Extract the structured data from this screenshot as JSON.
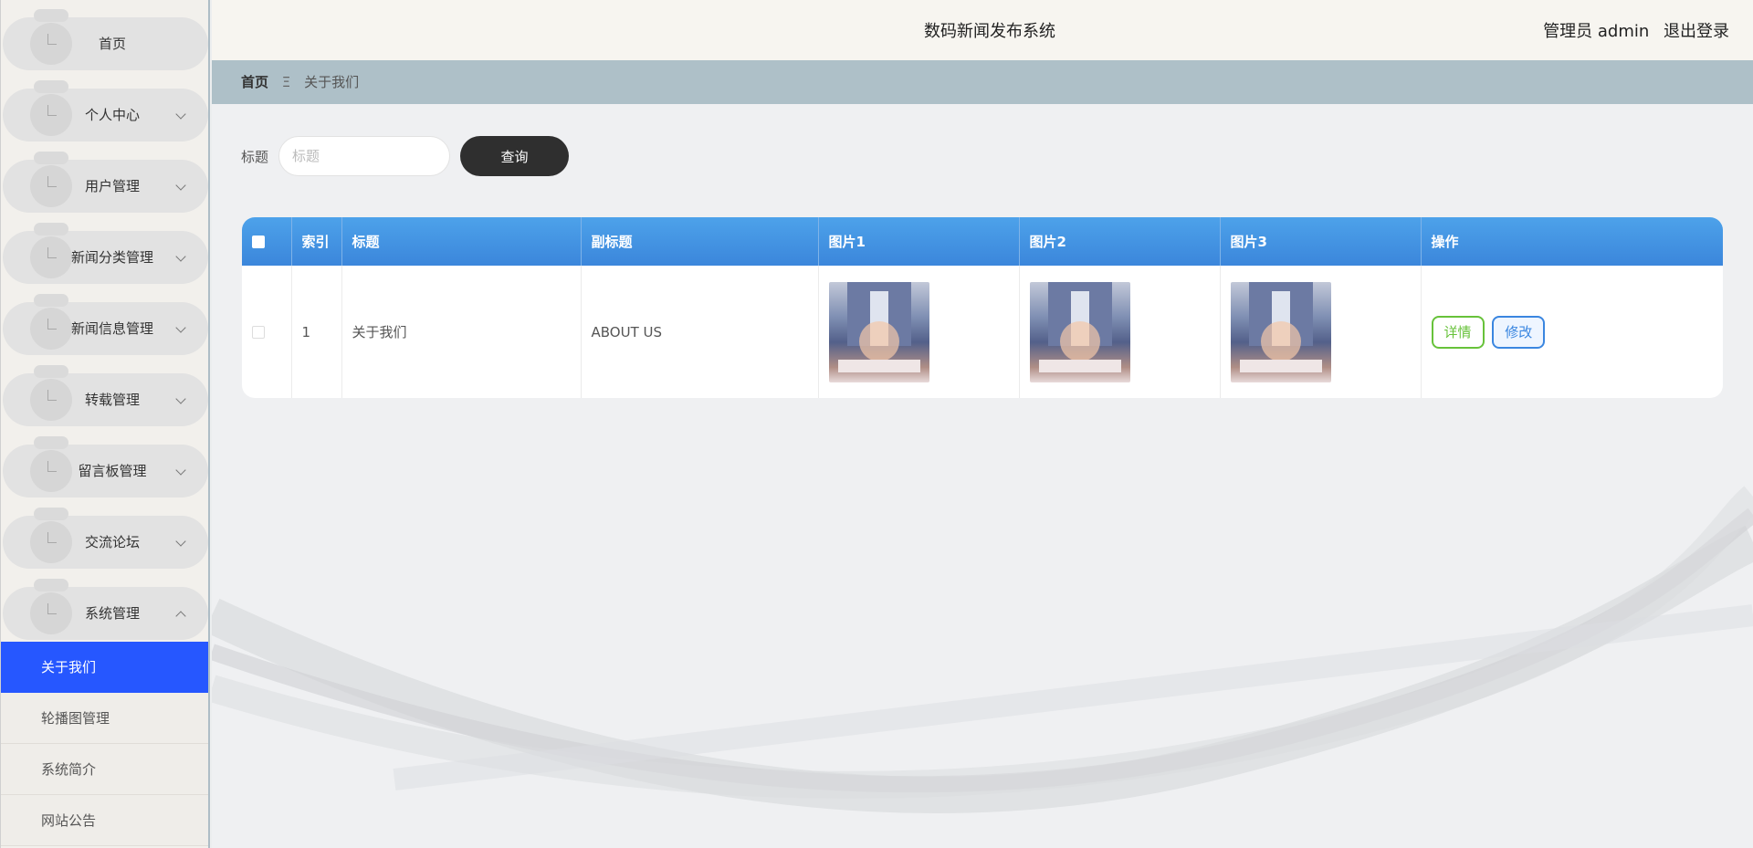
{
  "header": {
    "title": "数码新闻发布系统",
    "user_label": "管理员 admin",
    "logout_label": "退出登录"
  },
  "breadcrumb": {
    "home": "首页",
    "separator": "Ξ",
    "current": "关于我们"
  },
  "sidebar": {
    "items": [
      {
        "label": "首页"
      },
      {
        "label": "个人中心"
      },
      {
        "label": "用户管理"
      },
      {
        "label": "新闻分类管理"
      },
      {
        "label": "新闻信息管理"
      },
      {
        "label": "转载管理"
      },
      {
        "label": "留言板管理"
      },
      {
        "label": "交流论坛"
      },
      {
        "label": "系统管理"
      }
    ],
    "submenu": [
      {
        "label": "关于我们"
      },
      {
        "label": "轮播图管理"
      },
      {
        "label": "系统简介"
      },
      {
        "label": "网站公告"
      }
    ]
  },
  "search": {
    "label": "标题",
    "placeholder": "标题",
    "value": "",
    "button_label": "查询"
  },
  "table": {
    "headers": [
      "",
      "索引",
      "标题",
      "副标题",
      "图片1",
      "图片2",
      "图片3",
      "操作"
    ],
    "rows": [
      {
        "index": "1",
        "title": "关于我们",
        "subtitle": "ABOUT US"
      }
    ],
    "actions": {
      "detail": "详情",
      "edit": "修改"
    }
  },
  "colors": {
    "active_menu": "#2657ff",
    "table_header": "#3f8fe2",
    "search_button": "#2f2f2f",
    "detail_button": "#67c23a",
    "edit_button": "#3a86e0",
    "breadcrumb_bar": "#aec0c8"
  }
}
